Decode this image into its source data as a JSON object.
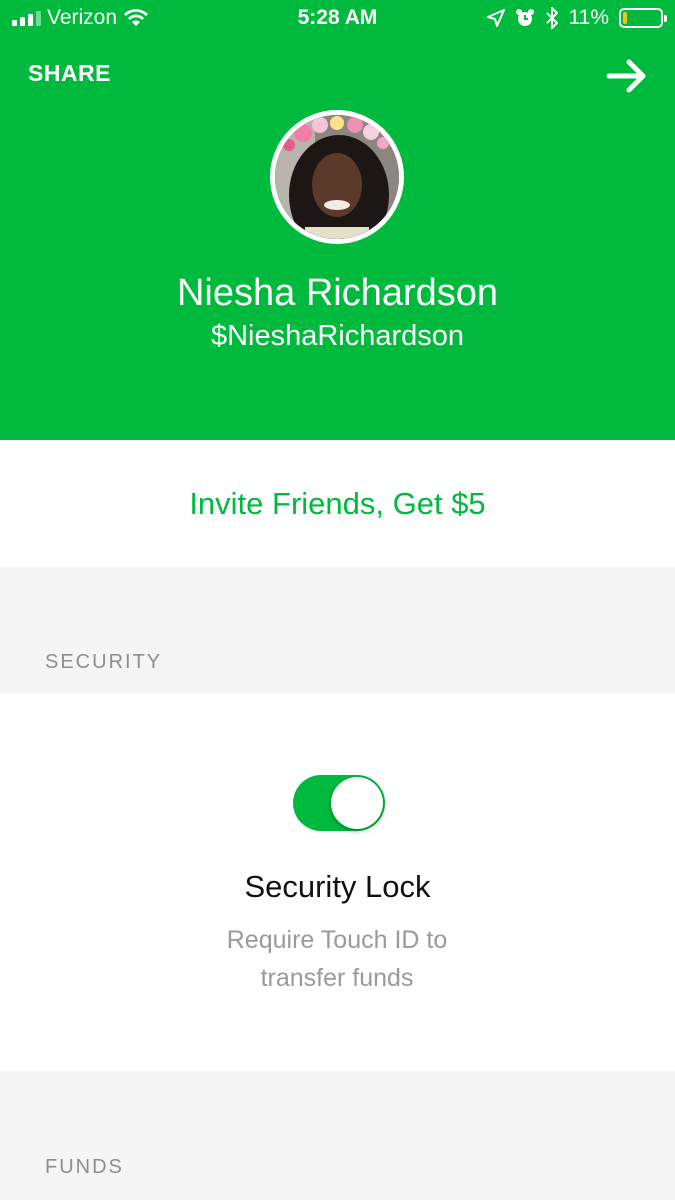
{
  "status_bar": {
    "carrier": "Verizon",
    "time": "5:28 AM",
    "battery": "11%",
    "battery_level": 0.11,
    "icons": [
      "signal-icon",
      "wifi-icon",
      "location-icon",
      "alarm-icon",
      "bluetooth-icon",
      "battery-icon"
    ]
  },
  "header": {
    "share_label": "SHARE",
    "forward_icon": "arrow-right-icon",
    "name": "Niesha Richardson",
    "cashtag": "$NieshaRichardson",
    "background": "#00ba3d"
  },
  "invite": {
    "label": "Invite Friends, Get $5",
    "color": "#00ba3d"
  },
  "security": {
    "section_label": "SECURITY",
    "toggle_on": true,
    "title": "Security Lock",
    "description": "Require Touch ID to transfer funds"
  },
  "funds": {
    "section_label": "FUNDS"
  }
}
